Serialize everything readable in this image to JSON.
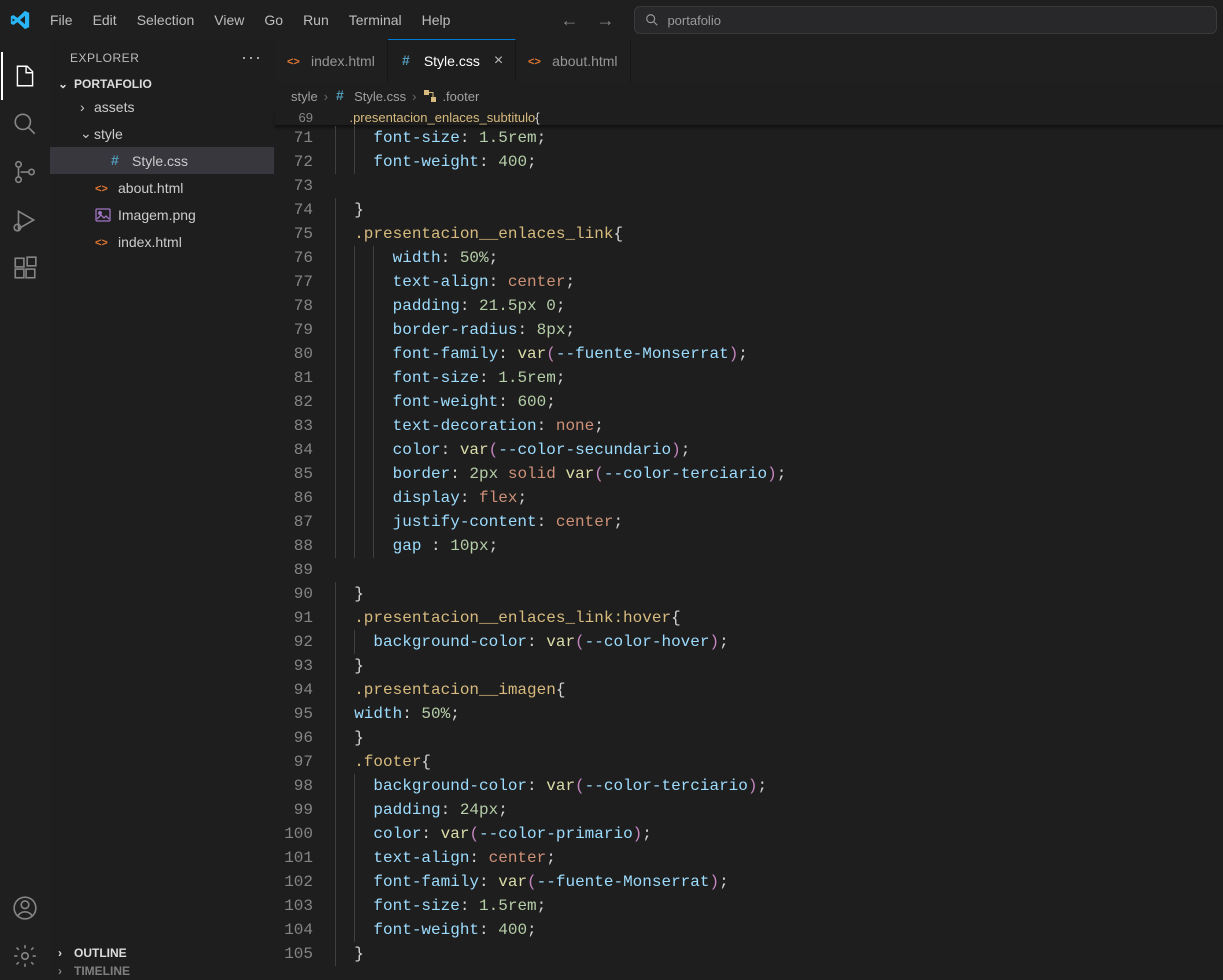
{
  "menubar": [
    "File",
    "Edit",
    "Selection",
    "View",
    "Go",
    "Run",
    "Terminal",
    "Help"
  ],
  "commandCenter": {
    "text": "portafolio"
  },
  "sidebar": {
    "title": "EXPLORER",
    "project": "PORTAFOLIO",
    "items": [
      {
        "kind": "folder",
        "name": "assets",
        "depth": 1,
        "expanded": false
      },
      {
        "kind": "folder",
        "name": "style",
        "depth": 1,
        "expanded": true
      },
      {
        "kind": "file",
        "name": "Style.css",
        "depth": 2,
        "iconColor": "#519aba",
        "selected": true,
        "icon": "hash"
      },
      {
        "kind": "file",
        "name": "about.html",
        "depth": 1,
        "iconColor": "#e37933",
        "icon": "html"
      },
      {
        "kind": "file",
        "name": "Imagem.png",
        "depth": 1,
        "iconColor": "#a074c4",
        "icon": "image"
      },
      {
        "kind": "file",
        "name": "index.html",
        "depth": 1,
        "iconColor": "#e37933",
        "icon": "html"
      }
    ],
    "outline": "OUTLINE",
    "timeline": "TIMELINE"
  },
  "tabs": [
    {
      "label": "index.html",
      "icon": "html",
      "iconColor": "#e37933",
      "active": false
    },
    {
      "label": "Style.css",
      "icon": "hash",
      "iconColor": "#519aba",
      "active": true
    },
    {
      "label": "about.html",
      "icon": "html",
      "iconColor": "#e37933",
      "active": false
    }
  ],
  "breadcrumbs": [
    "style",
    "Style.css",
    ".footer"
  ],
  "sticky": {
    "lineno": 69,
    "tokens": [
      {
        "t": ".presentacion_enlaces_subtitulo",
        "c": "tok-sel"
      },
      {
        "t": "{",
        "c": "tok-punc"
      }
    ]
  },
  "code": [
    {
      "n": 71,
      "i": 2,
      "seg": [
        {
          "t": "font-size",
          "c": "tok-prop"
        },
        {
          "t": ": ",
          "c": "tok-punc"
        },
        {
          "t": "1.5rem",
          "c": "tok-num"
        },
        {
          "t": ";",
          "c": "tok-punc"
        }
      ]
    },
    {
      "n": 72,
      "i": 2,
      "seg": [
        {
          "t": "font-weight",
          "c": "tok-prop"
        },
        {
          "t": ": ",
          "c": "tok-punc"
        },
        {
          "t": "400",
          "c": "tok-num"
        },
        {
          "t": ";",
          "c": "tok-punc"
        }
      ]
    },
    {
      "n": 73,
      "i": 0,
      "seg": []
    },
    {
      "n": 74,
      "i": 1,
      "seg": [
        {
          "t": "}",
          "c": "tok-punc"
        }
      ]
    },
    {
      "n": 75,
      "i": 1,
      "seg": [
        {
          "t": ".presentacion__enlaces_link",
          "c": "tok-sel"
        },
        {
          "t": "{",
          "c": "tok-punc"
        }
      ]
    },
    {
      "n": 76,
      "i": 3,
      "seg": [
        {
          "t": "width",
          "c": "tok-prop"
        },
        {
          "t": ": ",
          "c": "tok-punc"
        },
        {
          "t": "50%",
          "c": "tok-num"
        },
        {
          "t": ";",
          "c": "tok-punc"
        }
      ]
    },
    {
      "n": 77,
      "i": 3,
      "seg": [
        {
          "t": "text-align",
          "c": "tok-prop"
        },
        {
          "t": ": ",
          "c": "tok-punc"
        },
        {
          "t": "center",
          "c": "tok-val"
        },
        {
          "t": ";",
          "c": "tok-punc"
        }
      ]
    },
    {
      "n": 78,
      "i": 3,
      "seg": [
        {
          "t": "padding",
          "c": "tok-prop"
        },
        {
          "t": ": ",
          "c": "tok-punc"
        },
        {
          "t": "21.5px",
          "c": "tok-num"
        },
        {
          "t": " ",
          "c": "tok-punc"
        },
        {
          "t": "0",
          "c": "tok-num"
        },
        {
          "t": ";",
          "c": "tok-punc"
        }
      ]
    },
    {
      "n": 79,
      "i": 3,
      "seg": [
        {
          "t": "border-radius",
          "c": "tok-prop"
        },
        {
          "t": ": ",
          "c": "tok-punc"
        },
        {
          "t": "8px",
          "c": "tok-num"
        },
        {
          "t": ";",
          "c": "tok-punc"
        }
      ]
    },
    {
      "n": 80,
      "i": 3,
      "seg": [
        {
          "t": "font-family",
          "c": "tok-prop"
        },
        {
          "t": ": ",
          "c": "tok-punc"
        },
        {
          "t": "var",
          "c": "tok-fn"
        },
        {
          "t": "(",
          "c": "tok-paren"
        },
        {
          "t": "--fuente-Monserrat",
          "c": "tok-var"
        },
        {
          "t": ")",
          "c": "tok-paren"
        },
        {
          "t": ";",
          "c": "tok-punc"
        }
      ]
    },
    {
      "n": 81,
      "i": 3,
      "seg": [
        {
          "t": "font-size",
          "c": "tok-prop"
        },
        {
          "t": ": ",
          "c": "tok-punc"
        },
        {
          "t": "1.5rem",
          "c": "tok-num"
        },
        {
          "t": ";",
          "c": "tok-punc"
        }
      ]
    },
    {
      "n": 82,
      "i": 3,
      "seg": [
        {
          "t": "font-weight",
          "c": "tok-prop"
        },
        {
          "t": ": ",
          "c": "tok-punc"
        },
        {
          "t": "600",
          "c": "tok-num"
        },
        {
          "t": ";",
          "c": "tok-punc"
        }
      ]
    },
    {
      "n": 83,
      "i": 3,
      "seg": [
        {
          "t": "text-decoration",
          "c": "tok-prop"
        },
        {
          "t": ": ",
          "c": "tok-punc"
        },
        {
          "t": "none",
          "c": "tok-val"
        },
        {
          "t": ";",
          "c": "tok-punc"
        }
      ]
    },
    {
      "n": 84,
      "i": 3,
      "seg": [
        {
          "t": "color",
          "c": "tok-prop"
        },
        {
          "t": ": ",
          "c": "tok-punc"
        },
        {
          "t": "var",
          "c": "tok-fn"
        },
        {
          "t": "(",
          "c": "tok-paren"
        },
        {
          "t": "--color-secundario",
          "c": "tok-var"
        },
        {
          "t": ")",
          "c": "tok-paren"
        },
        {
          "t": ";",
          "c": "tok-punc"
        }
      ]
    },
    {
      "n": 85,
      "i": 3,
      "seg": [
        {
          "t": "border",
          "c": "tok-prop"
        },
        {
          "t": ": ",
          "c": "tok-punc"
        },
        {
          "t": "2px",
          "c": "tok-num"
        },
        {
          "t": " ",
          "c": "tok-punc"
        },
        {
          "t": "solid",
          "c": "tok-val"
        },
        {
          "t": " ",
          "c": "tok-punc"
        },
        {
          "t": "var",
          "c": "tok-fn"
        },
        {
          "t": "(",
          "c": "tok-paren"
        },
        {
          "t": "--color-terciario",
          "c": "tok-var"
        },
        {
          "t": ")",
          "c": "tok-paren"
        },
        {
          "t": ";",
          "c": "tok-punc"
        }
      ]
    },
    {
      "n": 86,
      "i": 3,
      "seg": [
        {
          "t": "display",
          "c": "tok-prop"
        },
        {
          "t": ": ",
          "c": "tok-punc"
        },
        {
          "t": "flex",
          "c": "tok-val"
        },
        {
          "t": ";",
          "c": "tok-punc"
        }
      ]
    },
    {
      "n": 87,
      "i": 3,
      "seg": [
        {
          "t": "justify-content",
          "c": "tok-prop"
        },
        {
          "t": ": ",
          "c": "tok-punc"
        },
        {
          "t": "center",
          "c": "tok-val"
        },
        {
          "t": ";",
          "c": "tok-punc"
        }
      ]
    },
    {
      "n": 88,
      "i": 3,
      "seg": [
        {
          "t": "gap ",
          "c": "tok-prop"
        },
        {
          "t": ": ",
          "c": "tok-punc"
        },
        {
          "t": "10px",
          "c": "tok-num"
        },
        {
          "t": ";",
          "c": "tok-punc"
        }
      ]
    },
    {
      "n": 89,
      "i": 0,
      "seg": []
    },
    {
      "n": 90,
      "i": 1,
      "seg": [
        {
          "t": "}",
          "c": "tok-punc"
        }
      ]
    },
    {
      "n": 91,
      "i": 1,
      "seg": [
        {
          "t": ".presentacion__enlaces_link:hover",
          "c": "tok-sel"
        },
        {
          "t": "{",
          "c": "tok-punc"
        }
      ]
    },
    {
      "n": 92,
      "i": 2,
      "seg": [
        {
          "t": "background-color",
          "c": "tok-prop"
        },
        {
          "t": ": ",
          "c": "tok-punc"
        },
        {
          "t": "var",
          "c": "tok-fn"
        },
        {
          "t": "(",
          "c": "tok-paren"
        },
        {
          "t": "--color-hover",
          "c": "tok-var"
        },
        {
          "t": ")",
          "c": "tok-paren"
        },
        {
          "t": ";",
          "c": "tok-punc"
        }
      ]
    },
    {
      "n": 93,
      "i": 1,
      "seg": [
        {
          "t": "}",
          "c": "tok-punc"
        }
      ]
    },
    {
      "n": 94,
      "i": 1,
      "seg": [
        {
          "t": ".presentacion__imagen",
          "c": "tok-sel"
        },
        {
          "t": "{",
          "c": "tok-punc"
        }
      ]
    },
    {
      "n": 95,
      "i": 1,
      "seg": [
        {
          "t": "width",
          "c": "tok-prop"
        },
        {
          "t": ": ",
          "c": "tok-punc"
        },
        {
          "t": "50%",
          "c": "tok-num"
        },
        {
          "t": ";",
          "c": "tok-punc"
        }
      ]
    },
    {
      "n": 96,
      "i": 1,
      "seg": [
        {
          "t": "}",
          "c": "tok-punc"
        }
      ]
    },
    {
      "n": 97,
      "i": 1,
      "seg": [
        {
          "t": ".footer",
          "c": "tok-sel"
        },
        {
          "t": "{",
          "c": "tok-punc"
        }
      ]
    },
    {
      "n": 98,
      "i": 2,
      "seg": [
        {
          "t": "background-color",
          "c": "tok-prop"
        },
        {
          "t": ": ",
          "c": "tok-punc"
        },
        {
          "t": "var",
          "c": "tok-fn"
        },
        {
          "t": "(",
          "c": "tok-paren"
        },
        {
          "t": "--color-terciario",
          "c": "tok-var"
        },
        {
          "t": ")",
          "c": "tok-paren"
        },
        {
          "t": ";",
          "c": "tok-punc"
        }
      ]
    },
    {
      "n": 99,
      "i": 2,
      "seg": [
        {
          "t": "padding",
          "c": "tok-prop"
        },
        {
          "t": ": ",
          "c": "tok-punc"
        },
        {
          "t": "24px",
          "c": "tok-num"
        },
        {
          "t": ";",
          "c": "tok-punc"
        }
      ]
    },
    {
      "n": 100,
      "i": 2,
      "seg": [
        {
          "t": "color",
          "c": "tok-prop"
        },
        {
          "t": ": ",
          "c": "tok-punc"
        },
        {
          "t": "var",
          "c": "tok-fn"
        },
        {
          "t": "(",
          "c": "tok-paren"
        },
        {
          "t": "--color-primario",
          "c": "tok-var"
        },
        {
          "t": ")",
          "c": "tok-paren"
        },
        {
          "t": ";",
          "c": "tok-punc"
        }
      ]
    },
    {
      "n": 101,
      "i": 2,
      "seg": [
        {
          "t": "text-align",
          "c": "tok-prop"
        },
        {
          "t": ": ",
          "c": "tok-punc"
        },
        {
          "t": "center",
          "c": "tok-val"
        },
        {
          "t": ";",
          "c": "tok-punc"
        }
      ]
    },
    {
      "n": 102,
      "i": 2,
      "seg": [
        {
          "t": "font-family",
          "c": "tok-prop"
        },
        {
          "t": ": ",
          "c": "tok-punc"
        },
        {
          "t": "var",
          "c": "tok-fn"
        },
        {
          "t": "(",
          "c": "tok-paren"
        },
        {
          "t": "--fuente-Monserrat",
          "c": "tok-var"
        },
        {
          "t": ")",
          "c": "tok-paren"
        },
        {
          "t": ";",
          "c": "tok-punc"
        }
      ]
    },
    {
      "n": 103,
      "i": 2,
      "seg": [
        {
          "t": "font-size",
          "c": "tok-prop"
        },
        {
          "t": ": ",
          "c": "tok-punc"
        },
        {
          "t": "1.5rem",
          "c": "tok-num"
        },
        {
          "t": ";",
          "c": "tok-punc"
        }
      ]
    },
    {
      "n": 104,
      "i": 2,
      "seg": [
        {
          "t": "font-weight",
          "c": "tok-prop"
        },
        {
          "t": ": ",
          "c": "tok-punc"
        },
        {
          "t": "400",
          "c": "tok-num"
        },
        {
          "t": ";",
          "c": "tok-punc"
        }
      ]
    },
    {
      "n": 105,
      "i": 1,
      "seg": [
        {
          "t": "}",
          "c": "tok-punc"
        }
      ]
    }
  ]
}
